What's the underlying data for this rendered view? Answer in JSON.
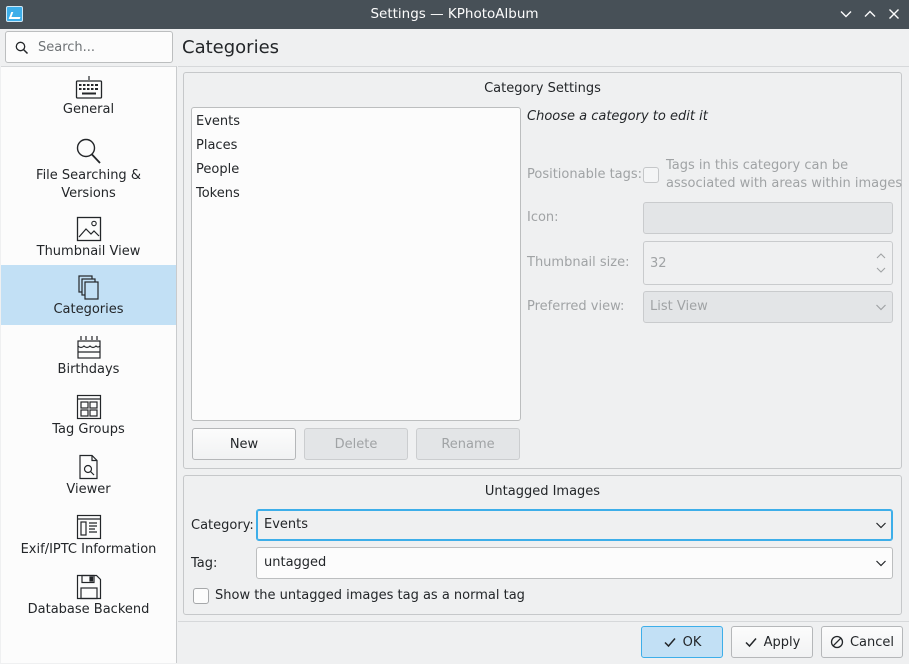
{
  "window": {
    "title": "Settings — KPhotoAlbum"
  },
  "search": {
    "placeholder": "Search..."
  },
  "sidebar": {
    "items": [
      {
        "label": "General",
        "icon": "keyboard-icon"
      },
      {
        "label": "File Searching &",
        "label2": "Versions",
        "icon": "search-icon"
      },
      {
        "label": "Thumbnail View",
        "icon": "image-icon"
      },
      {
        "label": "Categories",
        "icon": "categories-icon",
        "selected": true
      },
      {
        "label": "Birthdays",
        "icon": "cake-icon"
      },
      {
        "label": "Tag Groups",
        "icon": "tag-groups-icon"
      },
      {
        "label": "Viewer",
        "icon": "viewer-icon"
      },
      {
        "label": "Exif/IPTC Information",
        "icon": "exif-icon"
      },
      {
        "label": "Database Backend",
        "icon": "save-icon"
      }
    ]
  },
  "page": {
    "title": "Categories"
  },
  "category_settings": {
    "title": "Category Settings",
    "categories": [
      "Events",
      "Places",
      "People",
      "Tokens"
    ],
    "buttons": {
      "new": "New",
      "delete": "Delete",
      "rename": "Rename"
    },
    "hint": "Choose a category to edit it",
    "positionable_label": "Positionable tags:",
    "positionable_text1": "Tags in this category can be",
    "positionable_text2": "associated with areas within images",
    "icon_label": "Icon:",
    "thumbnail_size_label": "Thumbnail size:",
    "thumbnail_size_value": "32",
    "preferred_view_label": "Preferred view:",
    "preferred_view_value": "List View"
  },
  "untagged": {
    "title": "Untagged Images",
    "category_label": "Category:",
    "category_value": "Events",
    "tag_label": "Tag:",
    "tag_value": "untagged",
    "show_tag_label": "Show the untagged images tag as a normal tag"
  },
  "dialog_buttons": {
    "ok": "OK",
    "apply": "Apply",
    "cancel": "Cancel"
  },
  "colors": {
    "accent": "#3daee9",
    "selection": "#c2e0f5",
    "titlebar": "#475057"
  }
}
